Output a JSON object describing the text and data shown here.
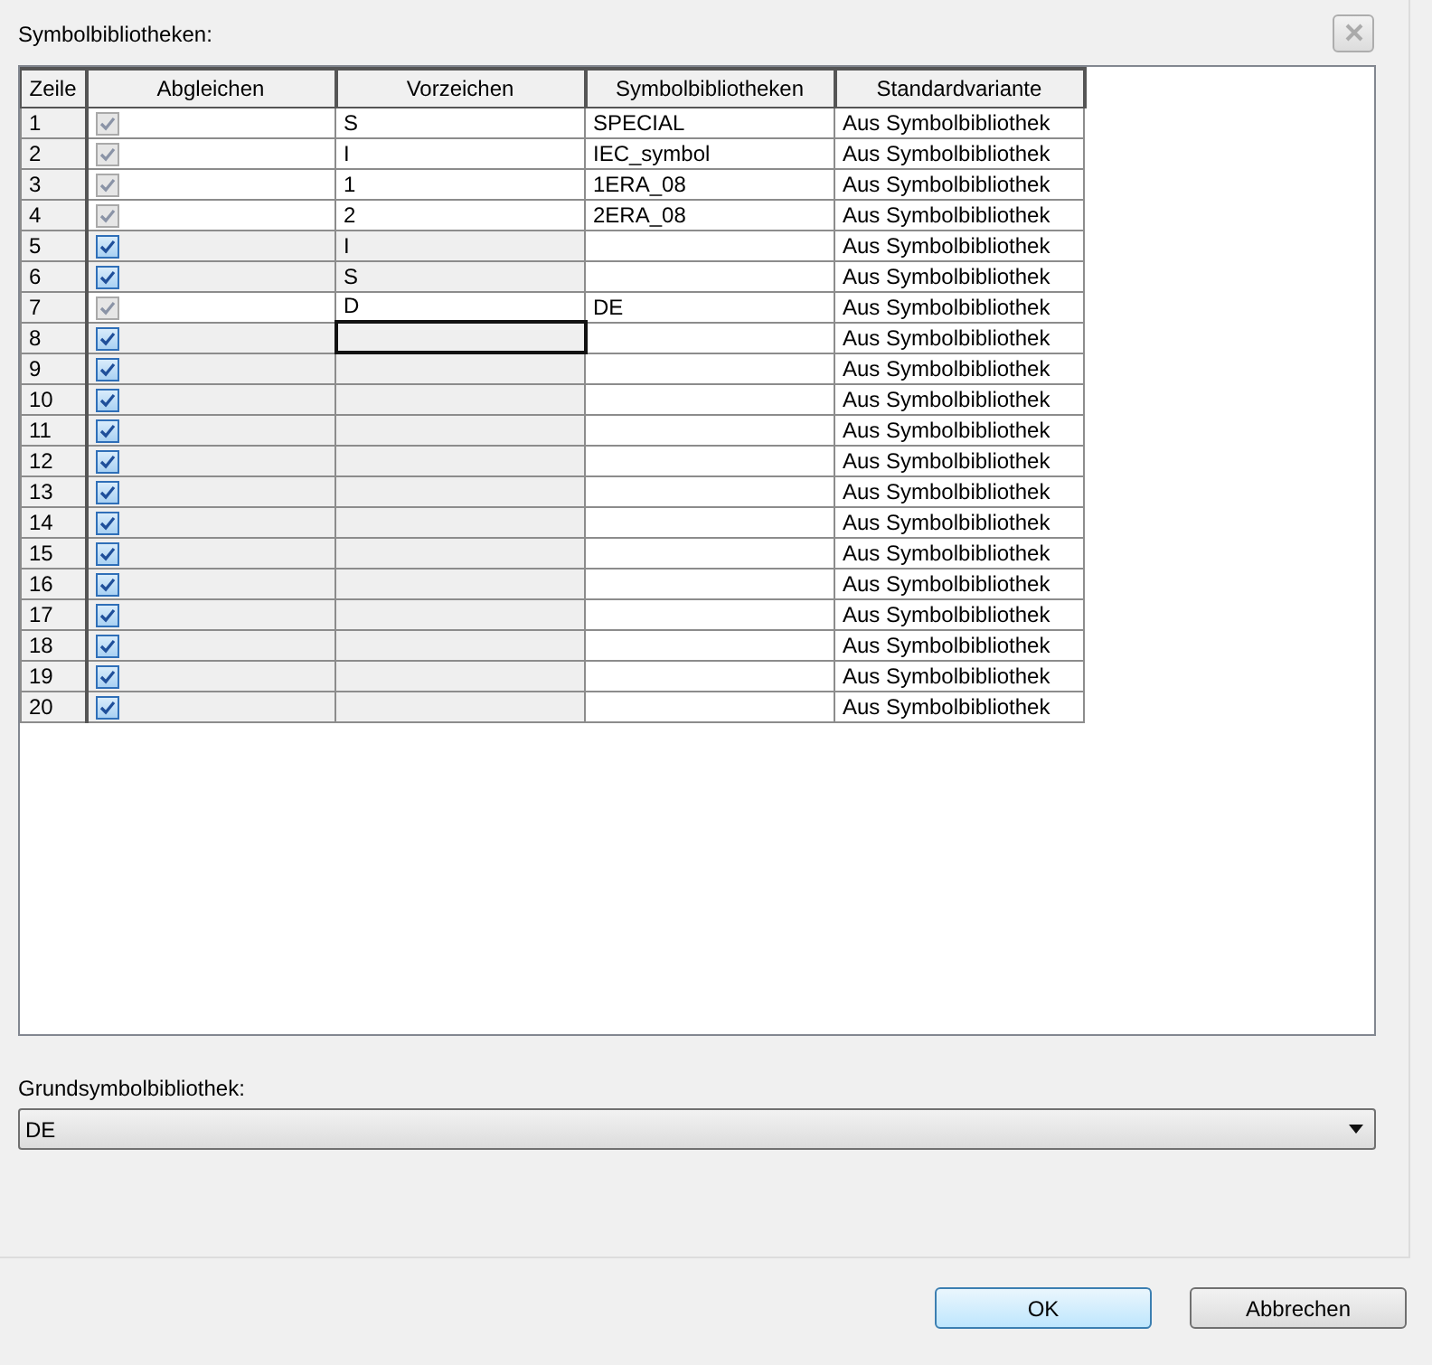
{
  "section_label": "Symbolbibliotheken:",
  "table": {
    "columns": [
      "Zeile",
      "Abgleichen",
      "Vorzeichen",
      "Symbolbibliotheken",
      "Standardvariante"
    ],
    "rows": [
      {
        "row": "1",
        "checked": true,
        "disabled": true,
        "vorzeichen": "S",
        "library": "SPECIAL",
        "variant": "Aus Symbolbibliothek",
        "focused": false
      },
      {
        "row": "2",
        "checked": true,
        "disabled": true,
        "vorzeichen": "I",
        "library": "IEC_symbol",
        "variant": "Aus Symbolbibliothek",
        "focused": false
      },
      {
        "row": "3",
        "checked": true,
        "disabled": true,
        "vorzeichen": "1",
        "library": "1ERA_08",
        "variant": "Aus Symbolbibliothek",
        "focused": false
      },
      {
        "row": "4",
        "checked": true,
        "disabled": true,
        "vorzeichen": "2",
        "library": "2ERA_08",
        "variant": "Aus Symbolbibliothek",
        "focused": false
      },
      {
        "row": "5",
        "checked": true,
        "disabled": false,
        "vorzeichen": "I",
        "variant": "Aus Symbolbibliothek",
        "focused": false
      },
      {
        "row": "6",
        "checked": true,
        "disabled": false,
        "vorzeichen": "S",
        "variant": "Aus Symbolbibliothek",
        "focused": false
      },
      {
        "row": "7",
        "checked": true,
        "disabled": true,
        "vorzeichen": "D",
        "library": "DE",
        "variant": "Aus Symbolbibliothek",
        "focused": false
      },
      {
        "row": "8",
        "checked": true,
        "disabled": false,
        "variant": "Aus Symbolbibliothek",
        "focused": true
      },
      {
        "row": "9",
        "checked": true,
        "disabled": false,
        "variant": "Aus Symbolbibliothek",
        "focused": false
      },
      {
        "row": "10",
        "checked": true,
        "disabled": false,
        "variant": "Aus Symbolbibliothek",
        "focused": false
      },
      {
        "row": "11",
        "checked": true,
        "disabled": false,
        "variant": "Aus Symbolbibliothek",
        "focused": false
      },
      {
        "row": "12",
        "checked": true,
        "disabled": false,
        "variant": "Aus Symbolbibliothek",
        "focused": false
      },
      {
        "row": "13",
        "checked": true,
        "disabled": false,
        "variant": "Aus Symbolbibliothek",
        "focused": false
      },
      {
        "row": "14",
        "checked": true,
        "disabled": false,
        "variant": "Aus Symbolbibliothek",
        "focused": false
      },
      {
        "row": "15",
        "checked": true,
        "disabled": false,
        "variant": "Aus Symbolbibliothek",
        "focused": false
      },
      {
        "row": "16",
        "checked": true,
        "disabled": false,
        "variant": "Aus Symbolbibliothek",
        "focused": false
      },
      {
        "row": "17",
        "checked": true,
        "disabled": false,
        "variant": "Aus Symbolbibliothek",
        "focused": false
      },
      {
        "row": "18",
        "checked": true,
        "disabled": false,
        "variant": "Aus Symbolbibliothek",
        "focused": false
      },
      {
        "row": "19",
        "checked": true,
        "disabled": false,
        "variant": "Aus Symbolbibliothek",
        "focused": false
      },
      {
        "row": "20",
        "checked": true,
        "disabled": false,
        "variant": "Aus Symbolbibliothek",
        "focused": false
      }
    ]
  },
  "base_library": {
    "label": "Grundsymbolbibliothek:",
    "value": "DE"
  },
  "buttons": [
    {
      "label": "OK",
      "kind": "default"
    },
    {
      "label": "Abbrechen",
      "kind": "normal"
    }
  ]
}
